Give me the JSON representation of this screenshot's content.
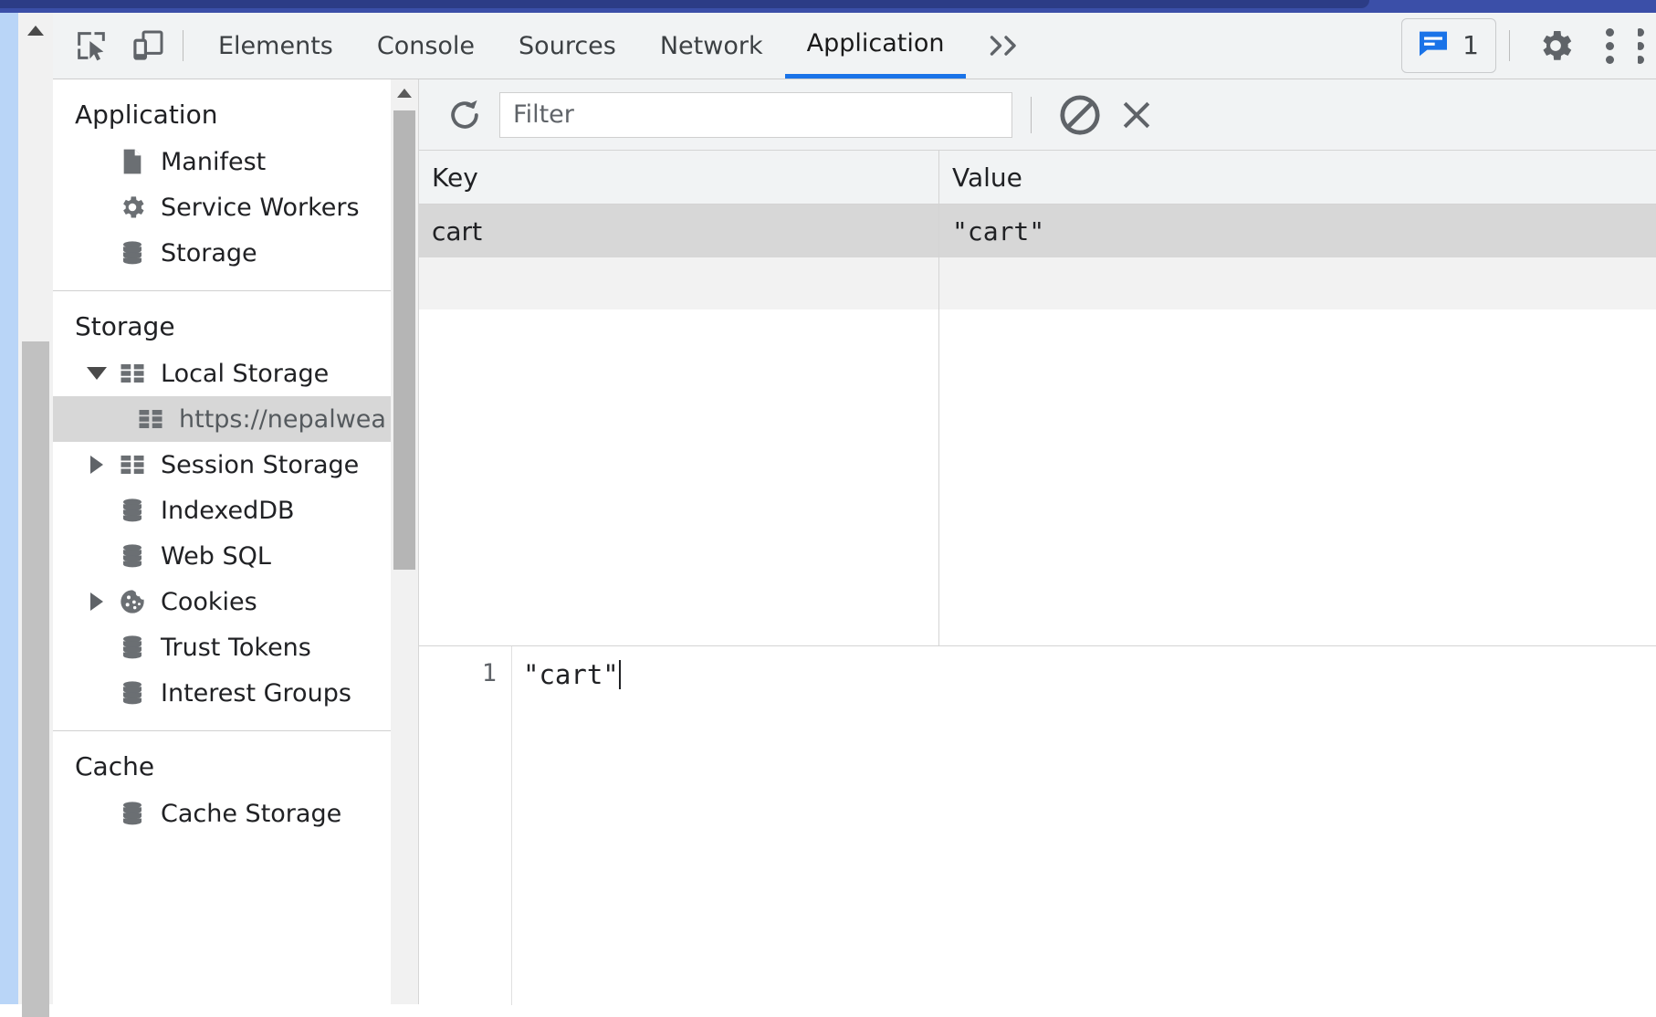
{
  "browser": {
    "chrome_color": "#3b4fa8"
  },
  "devtools": {
    "tabs": [
      {
        "label": "Elements",
        "active": false
      },
      {
        "label": "Console",
        "active": false
      },
      {
        "label": "Sources",
        "active": false
      },
      {
        "label": "Network",
        "active": false
      },
      {
        "label": "Application",
        "active": true
      }
    ],
    "more_tabs_glyph": "»",
    "inspect_icon": "inspect-element-icon",
    "device_toolbar_icon": "device-toolbar-icon",
    "message_count": "1",
    "message_icon": "console-message-icon",
    "settings_icon": "gear-icon",
    "menu_icon": "kebab-menu-icon",
    "accent_color": "#1a73e8"
  },
  "sidebar": {
    "sections": [
      {
        "title": "Application",
        "items": [
          {
            "label": "Manifest",
            "icon": "manifest-document-icon",
            "twisty": "none",
            "selected": false
          },
          {
            "label": "Service Workers",
            "icon": "gear-icon",
            "twisty": "none",
            "selected": false
          },
          {
            "label": "Storage",
            "icon": "database-icon",
            "twisty": "none",
            "selected": false
          }
        ]
      },
      {
        "title": "Storage",
        "items": [
          {
            "label": "Local Storage",
            "icon": "table-grid-icon",
            "twisty": "expanded",
            "selected": false
          },
          {
            "label": "https://nepalwea",
            "icon": "table-grid-icon",
            "twisty": "none",
            "selected": true,
            "child": true
          },
          {
            "label": "Session Storage",
            "icon": "table-grid-icon",
            "twisty": "collapsed",
            "selected": false
          },
          {
            "label": "IndexedDB",
            "icon": "database-icon",
            "twisty": "none",
            "selected": false
          },
          {
            "label": "Web SQL",
            "icon": "database-icon",
            "twisty": "none",
            "selected": false
          },
          {
            "label": "Cookies",
            "icon": "cookie-icon",
            "twisty": "collapsed",
            "selected": false
          },
          {
            "label": "Trust Tokens",
            "icon": "database-icon",
            "twisty": "none",
            "selected": false
          },
          {
            "label": "Interest Groups",
            "icon": "database-icon",
            "twisty": "none",
            "selected": false
          }
        ]
      },
      {
        "title": "Cache",
        "items": [
          {
            "label": "Cache Storage",
            "icon": "database-icon",
            "twisty": "none",
            "selected": false
          }
        ]
      }
    ]
  },
  "toolbar": {
    "refresh_icon": "refresh-icon",
    "filter_placeholder": "Filter",
    "filter_value": "",
    "clear_all_icon": "clear-all-circle-slash-icon",
    "delete_selected_icon": "close-x-icon"
  },
  "table": {
    "columns": [
      "Key",
      "Value"
    ],
    "rows": [
      {
        "key": "cart",
        "value": "\"cart\"",
        "selected": true
      }
    ]
  },
  "editor": {
    "line_number": "1",
    "content": "\"cart\""
  }
}
